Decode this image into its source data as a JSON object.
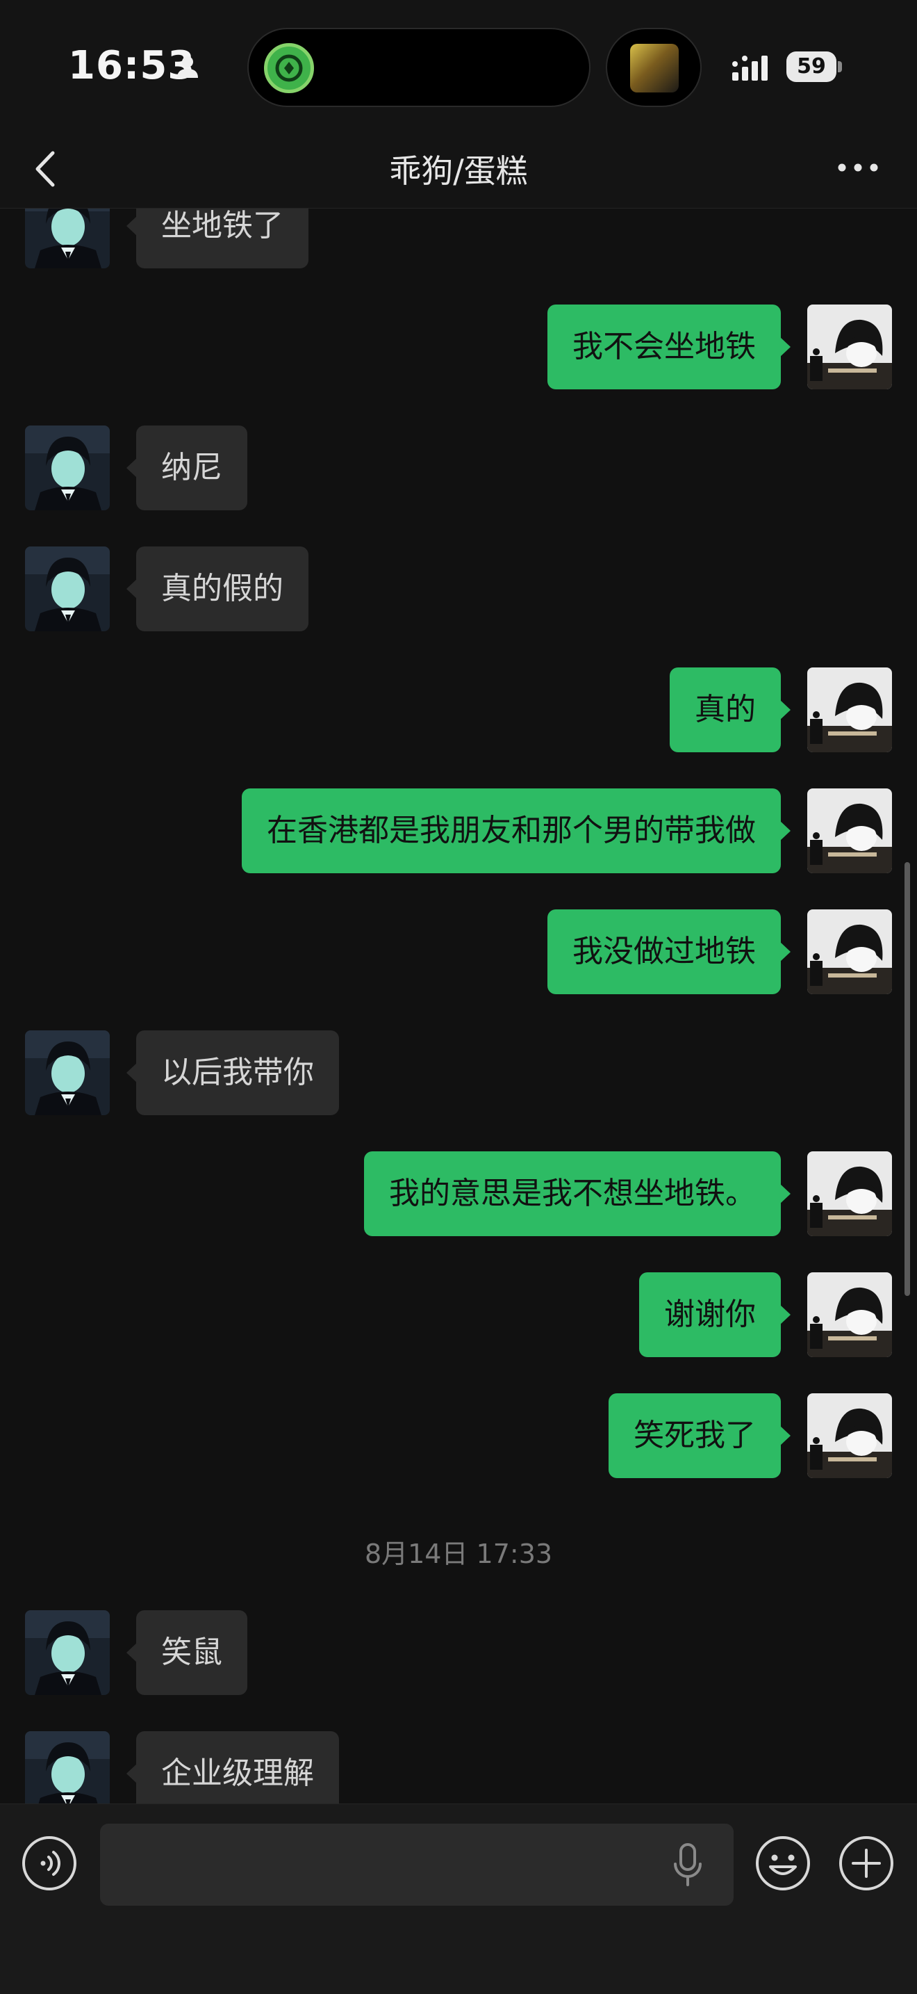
{
  "status_bar": {
    "time": "16:53",
    "battery": "59",
    "icons": [
      "person-icon",
      "dynamic-island-app-icon",
      "album-art",
      "signal-icon",
      "battery-icon"
    ]
  },
  "nav": {
    "title": "乖狗/蛋糕",
    "icons": [
      "back-icon",
      "more-icon"
    ]
  },
  "messages": [
    {
      "side": "left",
      "text": "坐地铁了"
    },
    {
      "side": "right",
      "text": "我不会坐地铁"
    },
    {
      "side": "left",
      "text": "纳尼"
    },
    {
      "side": "left",
      "text": "真的假的"
    },
    {
      "side": "right",
      "text": "真的"
    },
    {
      "side": "right",
      "text": "在香港都是我朋友和那个男的带我做"
    },
    {
      "side": "right",
      "text": "我没做过地铁"
    },
    {
      "side": "left",
      "text": "以后我带你"
    },
    {
      "side": "right",
      "text": "我的意思是我不想坐地铁。"
    },
    {
      "side": "right",
      "text": "谢谢你"
    },
    {
      "side": "right",
      "text": "笑死我了"
    },
    {
      "side": "left",
      "text": "笑鼠"
    },
    {
      "side": "left",
      "text": "企业级理解"
    }
  ],
  "timestamp": "8月14日 17:33",
  "input_bar": {
    "placeholder": "",
    "icons": [
      "voice-icon",
      "mic-icon",
      "emoji-icon",
      "plus-icon"
    ]
  },
  "colors": {
    "background": "#111111",
    "sent_bubble": "#2dbb64",
    "received_bubble": "#2b2b2b"
  }
}
